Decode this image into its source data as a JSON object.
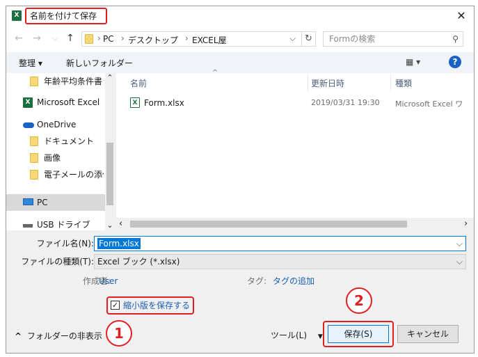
{
  "title": {
    "app_badge": "X",
    "text": "名前を付けて保存",
    "close": "✕"
  },
  "address": {
    "separator": "›",
    "crumbs": [
      "PC",
      "デスクトップ",
      "EXCEL屋"
    ],
    "dropdown": "⌵",
    "refresh": "↻",
    "search_placeholder": "Formの検索"
  },
  "toolbar": {
    "organize": "整理 ▾",
    "new_folder": "新しいフォルダー",
    "view": "▦ ▾",
    "help": "?"
  },
  "nav": {
    "items": [
      {
        "label": "年齢平均条件書き",
        "icon": "folder-icon"
      },
      {
        "label": "Microsoft Excel",
        "icon": "excel-icon"
      },
      {
        "label": "OneDrive",
        "icon": "cloud-icon"
      },
      {
        "label": "ドキュメント",
        "icon": "folder-icon"
      },
      {
        "label": "画像",
        "icon": "folder-icon"
      },
      {
        "label": "電子メールの添付ファ",
        "icon": "folder-icon"
      },
      {
        "label": "PC",
        "icon": "pc-icon"
      },
      {
        "label": "USB ドライブ (E:)",
        "icon": "usb-drive-icon"
      }
    ],
    "scroll_up": "⌃",
    "scroll_down": "⌄"
  },
  "files": {
    "columns": [
      "名前",
      "更新日時",
      "種類"
    ],
    "sort_indicator": "^",
    "rows": [
      {
        "name": "Form.xlsx",
        "modified": "2019/03/31 19:30",
        "type": "Microsoft Excel ワ"
      }
    ],
    "hscroll_left": "‹",
    "hscroll_right": "›"
  },
  "form": {
    "filename_label": "ファイル名(N):",
    "filename_value": "Form.xlsx",
    "filetype_label": "ファイルの種類(T):",
    "filetype_value": "Excel ブック (*.xlsx)",
    "author_label": "作成者:",
    "author_value": "User",
    "tags_label": "タグ:",
    "tags_value": "タグの追加",
    "thumbnail_label": "縮小版を保存する",
    "thumbnail_checked": true,
    "check_mark": "✓",
    "dropdown": "⌵"
  },
  "footer": {
    "hide_folders": "フォルダーの非表示",
    "hide_icon": "^",
    "tools": "ツール(L)",
    "tools_arrow": "▼",
    "save": "保存(S)",
    "cancel": "キャンセル"
  },
  "annotations": {
    "one": "1",
    "two": "2"
  },
  "colors": {
    "accent": "#1c62c4",
    "highlight": "#e02020",
    "excel_green": "#1d6f42",
    "selection": "#0078d7"
  }
}
